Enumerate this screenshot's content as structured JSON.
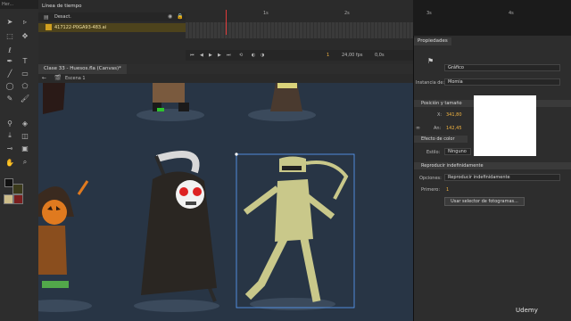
{
  "toolbar": {
    "header": "Her..."
  },
  "timeline": {
    "tab": "Línea de tiempo",
    "layers": [
      {
        "name": "Desact."
      },
      {
        "name": "417122-P0GA93-483.ai"
      }
    ],
    "ruler_labels": [
      "1s",
      "2s",
      "3s",
      "4s"
    ],
    "current_frame": "1",
    "fps": "24,00 fps",
    "time": "0,0s"
  },
  "document": {
    "tab": "Clase 33 - Huesos.fla (Canvas)*",
    "scene": "Escena 1"
  },
  "properties": {
    "tab": "Propiedades",
    "symbol_type": "Gráfico",
    "instance_label": "Instancia de:",
    "instance_value": "Momia",
    "position_section": "Posición y tamaño",
    "x_label": "X:",
    "x_value": "341,80",
    "w_label": "An:",
    "w_value": "142,45",
    "color_section": "Efecto de color",
    "style_label": "Estilo:",
    "style_value": "Ninguno",
    "loop_section": "Reproducir indefinidamente",
    "options_label": "Opciones:",
    "options_value": "Reproducir indefinidamente",
    "first_label": "Primero:",
    "first_value": "1",
    "frame_picker_button": "Usar selector de fotogramas..."
  },
  "watermark": "Udemy"
}
